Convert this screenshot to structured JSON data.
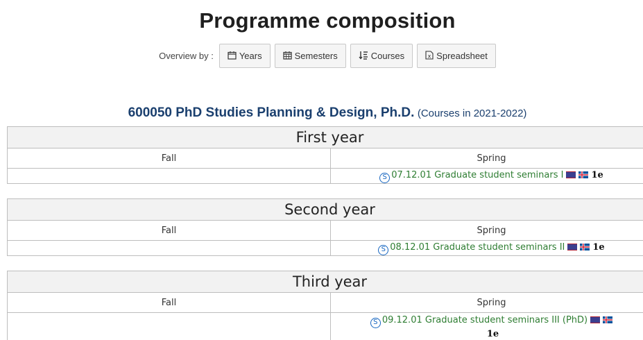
{
  "page": {
    "title": "Programme composition"
  },
  "overview": {
    "label": "Overview by :",
    "buttons": [
      {
        "label": "Years",
        "icon": "calendar-icon"
      },
      {
        "label": "Semesters",
        "icon": "calendar-grid-icon"
      },
      {
        "label": "Courses",
        "icon": "sort-list-icon"
      },
      {
        "label": "Spreadsheet",
        "icon": "spreadsheet-icon"
      }
    ]
  },
  "programme": {
    "name": "600050 PhD Studies Planning & Design, Ph.D.",
    "subtitle": "(Courses in 2021-2022)"
  },
  "years": [
    {
      "title": "First year",
      "fall_label": "Fall",
      "spring_label": "Spring",
      "course": {
        "badge": "S",
        "text": "07.12.01 Graduate student seminars I",
        "credits": "1e"
      }
    },
    {
      "title": "Second year",
      "fall_label": "Fall",
      "spring_label": "Spring",
      "course": {
        "badge": "S",
        "text": "08.12.01 Graduate student seminars II",
        "credits": "1e"
      }
    },
    {
      "title": "Third year",
      "fall_label": "Fall",
      "spring_label": "Spring",
      "course": {
        "badge": "S",
        "text": "09.12.01 Graduate student seminars III (PhD)",
        "credits": "1e"
      }
    }
  ],
  "colors": {
    "programme_heading": "#1a3f6e",
    "course_link": "#2e7d32",
    "badge": "#1565c0",
    "year_header_bg": "#f2f2f2"
  }
}
